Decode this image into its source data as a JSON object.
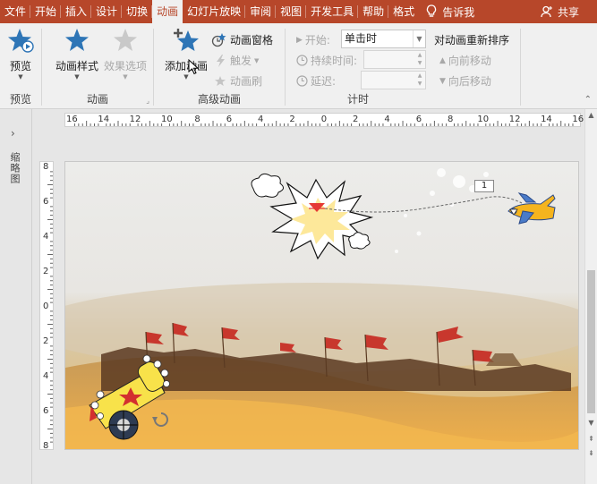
{
  "tabs": [
    {
      "label": "文件",
      "active": false
    },
    {
      "label": "开始",
      "active": false
    },
    {
      "label": "插入",
      "active": false
    },
    {
      "label": "设计",
      "active": false
    },
    {
      "label": "切换",
      "active": false
    },
    {
      "label": "动画",
      "active": true
    },
    {
      "label": "幻灯片放映",
      "active": false
    },
    {
      "label": "审阅",
      "active": false
    },
    {
      "label": "视图",
      "active": false
    },
    {
      "label": "开发工具",
      "active": false
    },
    {
      "label": "帮助",
      "active": false
    },
    {
      "label": "格式",
      "active": false
    }
  ],
  "tell_me": "告诉我",
  "share": "共享",
  "ribbon": {
    "preview": {
      "button": "预览",
      "group": "预览"
    },
    "animation": {
      "style_button": "动画样式",
      "effect_button": "效果选项",
      "group": "动画"
    },
    "advanced": {
      "add_button": "添加动画",
      "pane": "动画窗格",
      "trigger": "触发",
      "painter": "动画刷",
      "group": "高级动画"
    },
    "timing": {
      "start_label": "开始:",
      "start_value": "单击时",
      "duration_label": "持续时间:",
      "duration_value": "",
      "delay_label": "延迟:",
      "delay_value": "",
      "group": "计时"
    },
    "reorder": {
      "title": "对动画重新排序",
      "earlier": "向前移动",
      "later": "向后移动"
    }
  },
  "left_pane": {
    "label": "缩略图"
  },
  "ruler": {
    "horizontal": [
      "16",
      "14",
      "12",
      "10",
      "8",
      "6",
      "4",
      "2",
      "0",
      "2",
      "4",
      "6",
      "8",
      "10",
      "12",
      "14",
      "16"
    ],
    "vertical": [
      "8",
      "6",
      "4",
      "2",
      "0",
      "2",
      "4",
      "6",
      "8"
    ]
  },
  "slide": {
    "animation_marker": "1"
  },
  "colors": {
    "accent": "#b7472a",
    "ribbon_bg": "#f0f0f0",
    "star_blue": "#2e75b6",
    "disabled": "#a8a8a8"
  }
}
